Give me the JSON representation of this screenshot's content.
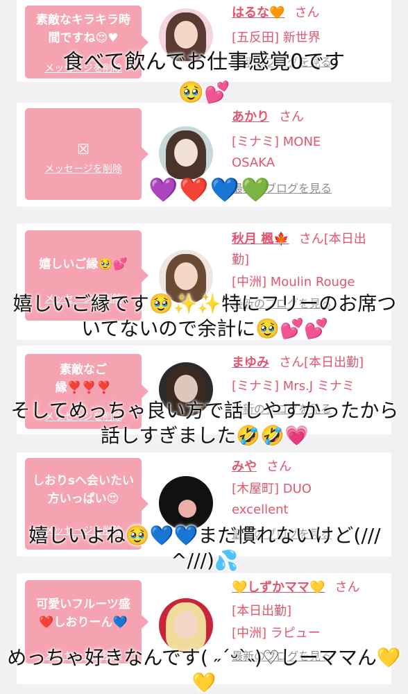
{
  "messages": [
    {
      "bubble": "素敵なキラキラ時間ですね😍♥",
      "delete": "メッセージを削除",
      "name": "はるな🧡",
      "san": "さん",
      "status": "",
      "shop": "[五反田] 新世界",
      "blog": "最新のブログを見る"
    },
    {
      "bubble_icon": "☒",
      "delete": "メッセージを削除",
      "name": "あかり",
      "san": "さん",
      "status": "",
      "shop": "[ミナミ] MONE OSAKA",
      "blog": "最新のブログを見る"
    },
    {
      "bubble": "嬉しいご縁🥹💕",
      "delete": "メッセージを削除",
      "name": "秋月 楓🍁",
      "san": "さん",
      "status": "[本日出勤]",
      "shop": "[中洲] Moulin Rouge",
      "blog": "最新のブログを見る"
    },
    {
      "bubble": "素敵なご縁❣️❣️❣️",
      "delete": "メッセージを削除",
      "name": "まゆみ",
      "san": "さん",
      "status": "[本日出勤]",
      "shop": "[ミナミ] Mrs.J ミナミ",
      "blog": "最新のブログを見る"
    },
    {
      "bubble": "しおりsへ会いたい方いっぱい😍",
      "delete": "メッセージを削除",
      "name": "みや",
      "san": "さん",
      "status": "",
      "shop": "[木屋町] DUO excellent",
      "blog": "最新のブログを見る"
    },
    {
      "bubble": "可愛いフルーツ盛❤️しおりーん💙",
      "delete": "メッセージを削除",
      "name": "💛しずかママ💛",
      "san": "さん",
      "status": "[本日出勤]",
      "shop": "[中洲] ラピュー",
      "blog": "最新のブログを見る"
    }
  ],
  "captions": {
    "c1": "食べて飲んでお仕事感覚0です",
    "c1b": "🥹💕",
    "hearts": "💜❤️💙💚",
    "c2": "嬉しいご縁です🥹✨✨特にフリーのお席ついてないので余計に🥹💕💕",
    "c3": "そしてめっちゃ良い方で話しやすかったから話しすぎました🤣🤣💗",
    "c4": "嬉しいよね🥹💙💙まだ慣れないけど(/// ^///)💦",
    "c5": "めっちゃ好きなんです( ˶ˊᵕˋ˵)♡しーママん💛💛"
  },
  "colors": {
    "bubble": "#f6a3b1",
    "name": "#e3556e",
    "background": "#f1f1f3"
  }
}
